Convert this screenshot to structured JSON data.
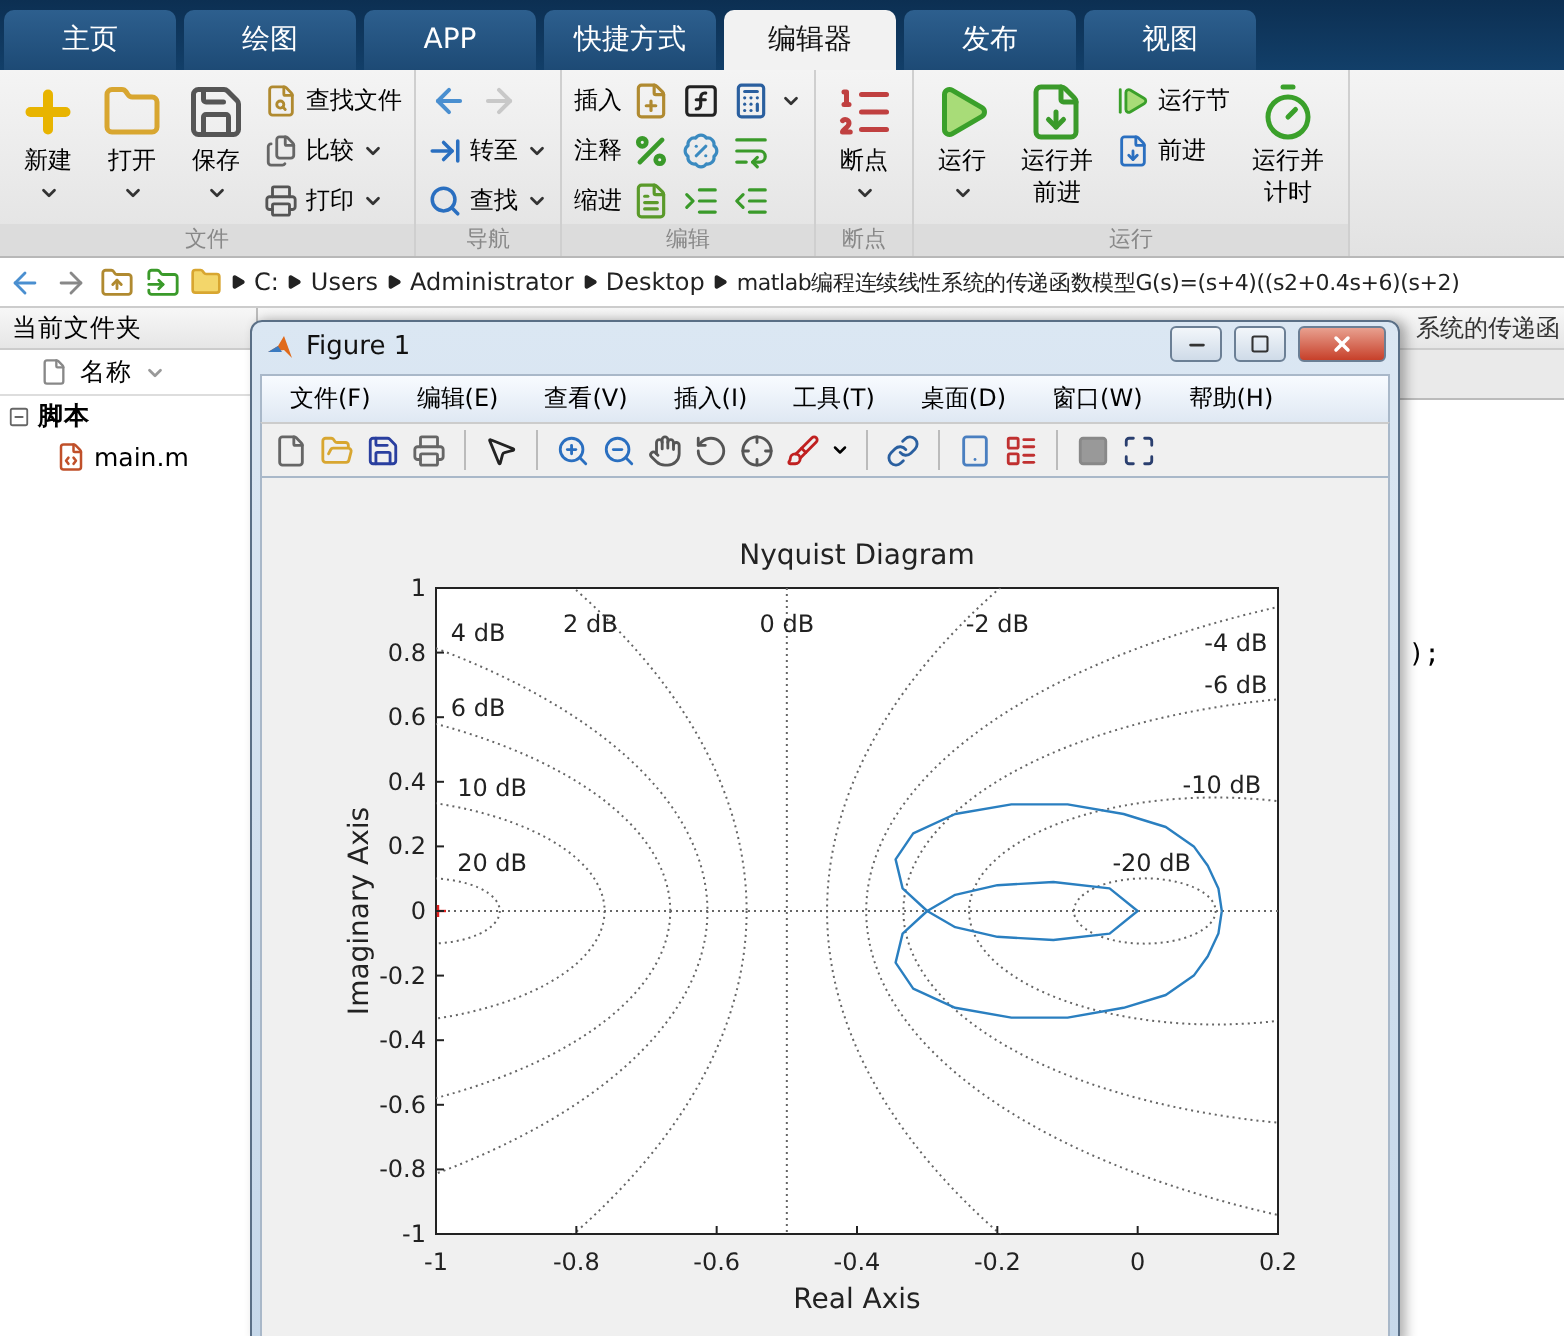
{
  "ribbon": {
    "tabs": [
      {
        "label": "主页",
        "selected": false
      },
      {
        "label": "绘图",
        "selected": false
      },
      {
        "label": "APP",
        "selected": false
      },
      {
        "label": "快捷方式",
        "selected": false
      },
      {
        "label": "编辑器",
        "selected": true
      },
      {
        "label": "发布",
        "selected": false
      },
      {
        "label": "视图",
        "selected": false
      }
    ],
    "groups": [
      {
        "label": "文件",
        "items": [
          {
            "kind": "large",
            "label": "新建",
            "dropdown": true
          },
          {
            "kind": "large",
            "label": "打开",
            "dropdown": true
          },
          {
            "kind": "large",
            "label": "保存",
            "dropdown": true
          },
          {
            "kind": "column",
            "rows": [
              {
                "label": "查找文件"
              },
              {
                "label": "比较",
                "dropdown": true
              },
              {
                "label": "打印",
                "dropdown": true
              }
            ]
          }
        ]
      },
      {
        "label": "导航",
        "items": [
          {
            "kind": "column",
            "rows": [
              {
                "icons": [
                  {
                    "disabled": false
                  },
                  {
                    "disabled": true
                  }
                ]
              },
              {
                "label": "转至",
                "dropdown": true
              },
              {
                "label": "查找",
                "dropdown": true
              }
            ]
          }
        ]
      },
      {
        "label": "编辑",
        "items": [
          {
            "kind": "column",
            "rows": [
              {
                "label": "插入",
                "icons": [
                  {
                    "disabled": false
                  },
                  {
                    "disabled": false
                  },
                  {
                    "disabled": false
                  }
                ],
                "dropdown": true
              },
              {
                "label": "注释",
                "icons": [
                  {
                    "disabled": false
                  },
                  {
                    "disabled": false
                  },
                  {
                    "disabled": false
                  }
                ]
              },
              {
                "label": "缩进",
                "icons": [
                  {
                    "disabled": false
                  },
                  {
                    "disabled": false
                  },
                  {
                    "disabled": false
                  }
                ]
              }
            ]
          }
        ]
      },
      {
        "label": "断点",
        "items": [
          {
            "kind": "large",
            "label": "断点",
            "dropdown": true
          }
        ]
      },
      {
        "label": "运行",
        "items": [
          {
            "kind": "large",
            "label": "运行",
            "dropdown": true
          },
          {
            "kind": "large",
            "label": "运行并前进"
          },
          {
            "kind": "column",
            "rows": [
              {
                "label": "运行节"
              },
              {
                "label": "前进"
              }
            ]
          },
          {
            "kind": "large",
            "label": "运行并计时"
          }
        ]
      }
    ]
  },
  "path_bar": {
    "breadcrumbs": [
      "C:",
      "Users",
      "Administrator",
      "Desktop",
      "matlab编程连续线性系统的传递函数模型G(s)=(s+4)((s2+0.4s+6)(s+2)"
    ]
  },
  "current_folder": {
    "title": "当前文件夹",
    "column": "名称",
    "tree": [
      {
        "label": "脚本",
        "expanded": true,
        "children": [
          {
            "label": "main.m"
          }
        ]
      }
    ]
  },
  "editor": {
    "tab_title": "系统的传递函",
    "code_fragment": ");"
  },
  "figure": {
    "title": "Figure 1",
    "menus": [
      "文件(F)",
      "编辑(E)",
      "查看(V)",
      "插入(I)",
      "工具(T)",
      "桌面(D)",
      "窗口(W)",
      "帮助(H)"
    ],
    "chart_data": {
      "type": "line",
      "title": "Nyquist Diagram",
      "xlabel": "Real Axis",
      "ylabel": "Imaginary Axis",
      "xlim": [
        -1,
        0.2
      ],
      "ylim": [
        -1,
        1
      ],
      "xticks": [
        -1,
        -0.8,
        -0.6,
        -0.4,
        -0.2,
        0,
        0.2
      ],
      "yticks": [
        -1,
        -0.8,
        -0.6,
        -0.4,
        -0.2,
        0,
        0.2,
        0.4,
        0.6,
        0.8,
        1
      ],
      "annotations": [
        "4 dB",
        "6 dB",
        "10 dB",
        "20 dB",
        "2 dB",
        "0 dB",
        "-2 dB",
        "-4 dB",
        "-6 dB",
        "-10 dB",
        "-20 dB"
      ]
    }
  }
}
